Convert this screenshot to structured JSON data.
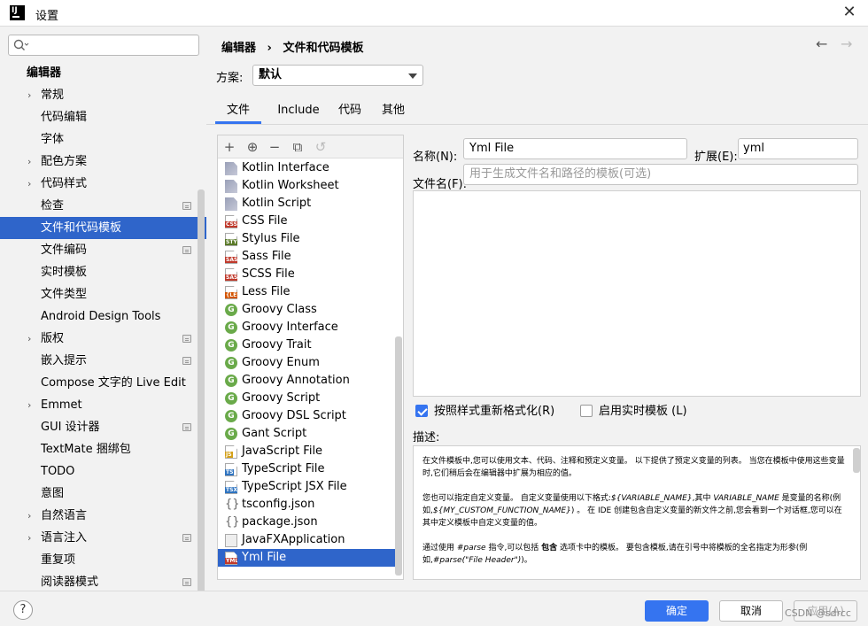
{
  "window": {
    "title": "设置",
    "logo": "IJ"
  },
  "search": {
    "placeholder": ""
  },
  "sidebar": {
    "items": [
      {
        "label": "编辑器"
      },
      {
        "label": "常规"
      },
      {
        "label": "代码编辑"
      },
      {
        "label": "字体"
      },
      {
        "label": "配色方案"
      },
      {
        "label": "代码样式"
      },
      {
        "label": "检查"
      },
      {
        "label": "文件和代码模板"
      },
      {
        "label": "文件编码"
      },
      {
        "label": "实时模板"
      },
      {
        "label": "文件类型"
      },
      {
        "label": "Android Design Tools"
      },
      {
        "label": "版权"
      },
      {
        "label": "嵌入提示"
      },
      {
        "label": "Compose 文字的 Live Edit"
      },
      {
        "label": "Emmet"
      },
      {
        "label": "GUI 设计器"
      },
      {
        "label": "TextMate 捆绑包"
      },
      {
        "label": "TODO"
      },
      {
        "label": "意图"
      },
      {
        "label": "自然语言"
      },
      {
        "label": "语言注入"
      },
      {
        "label": "重复项"
      },
      {
        "label": "阅读器模式"
      }
    ]
  },
  "breadcrumb": {
    "parent": "编辑器",
    "separator": "›",
    "current": "文件和代码模板"
  },
  "scheme": {
    "label": "方案:",
    "value": "默认"
  },
  "tabs": [
    {
      "label": "文件"
    },
    {
      "label": "Include"
    },
    {
      "label": "代码"
    },
    {
      "label": "其他"
    }
  ],
  "toolbar": {
    "add": "+",
    "copy_add": "⊕",
    "remove": "−",
    "copy": "⧉",
    "reset": "↺"
  },
  "templates": [
    {
      "label": "Kotlin Interface",
      "icon": "kotlin"
    },
    {
      "label": "Kotlin Worksheet",
      "icon": "kotlin"
    },
    {
      "label": "Kotlin Script",
      "icon": "kotlin"
    },
    {
      "label": "CSS File",
      "icon": "doc",
      "tag": "CSS",
      "color": "#c0392b"
    },
    {
      "label": "Stylus File",
      "icon": "doc",
      "tag": "STYL",
      "color": "#5a7a28"
    },
    {
      "label": "Sass File",
      "icon": "doc",
      "tag": "SASS",
      "color": "#c0392b"
    },
    {
      "label": "SCSS File",
      "icon": "doc",
      "tag": "SASS",
      "color": "#c0392b"
    },
    {
      "label": "Less File",
      "icon": "doc",
      "tag": "{LES}",
      "color": "#d35400"
    },
    {
      "label": "Groovy Class",
      "icon": "groovy",
      "tag": "G"
    },
    {
      "label": "Groovy Interface",
      "icon": "groovy",
      "tag": "G"
    },
    {
      "label": "Groovy Trait",
      "icon": "groovy",
      "tag": "G"
    },
    {
      "label": "Groovy Enum",
      "icon": "groovy",
      "tag": "G"
    },
    {
      "label": "Groovy Annotation",
      "icon": "groovy",
      "tag": "G"
    },
    {
      "label": "Groovy Script",
      "icon": "groovy",
      "tag": "G"
    },
    {
      "label": "Groovy DSL Script",
      "icon": "groovy",
      "tag": "G"
    },
    {
      "label": "Gant Script",
      "icon": "groovy",
      "tag": "G"
    },
    {
      "label": "JavaScript File",
      "icon": "doc",
      "tag": "JS",
      "color": "#d4a017"
    },
    {
      "label": "TypeScript File",
      "icon": "doc",
      "tag": "TS",
      "color": "#2f74c0"
    },
    {
      "label": "TypeScript JSX File",
      "icon": "doc",
      "tag": "TSX",
      "color": "#2f74c0"
    },
    {
      "label": "tsconfig.json",
      "icon": "json",
      "tag": "{}"
    },
    {
      "label": "package.json",
      "icon": "json",
      "tag": "{}"
    },
    {
      "label": "JavaFXApplication",
      "icon": "java"
    },
    {
      "label": "Yml File",
      "icon": "doc",
      "tag": "YML",
      "color": "#c0392b"
    }
  ],
  "form": {
    "name_label": "名称(N):",
    "name_value": "Yml File",
    "ext_label": "扩展(E):",
    "ext_value": "yml",
    "filename_label": "文件名(F):",
    "filename_placeholder": "用于生成文件名和路径的模板(可选)",
    "reformat_label": "按照样式重新格式化(R)",
    "reformat_checked": true,
    "live_label": "启用实时模板 (L)",
    "live_checked": false,
    "desc_label": "描述:"
  },
  "description": {
    "p1": "在文件模板中,您可以使用文本、代码、注释和预定义变量。 以下提供了预定义变量的列表。 当您在模板中使用这些变量时,它们稍后会在编辑器中扩展为相应的值。",
    "p2_a": "您也可以指定自定义变量。 自定义变量使用以下格式:",
    "p2_var": "${VARIABLE_NAME}",
    "p2_b": ",其中 ",
    "p2_var2": "VARIABLE_NAME",
    "p2_c": " 是变量的名称(例如,",
    "p2_var3": "${MY_CUSTOM_FUNCTION_NAME}",
    "p2_d": ") 。 在 IDE 创建包含自定义变量的新文件之前,您会看到一个对话框,您可以在其中定义模板中自定义变量的值。",
    "p3_a": "通过使用 ",
    "p3_kw": "#parse",
    "p3_b": " 指令,可以包括 ",
    "p3_bold": "包含",
    "p3_c": " 选项卡中的模板。 要包含模板,请在引号中将模板的全名指定为形参(例如,",
    "p3_kw2": "#parse(\"File Header\")",
    "p3_d": ")。"
  },
  "buttons": {
    "ok": "确定",
    "cancel": "取消",
    "apply": "应用(A)",
    "help": "?"
  },
  "watermark": "CSDN @sdrcc",
  "colors": {
    "selection": "#2f65ca",
    "primary": "#3574f0",
    "groovy": "#6aaa4a"
  }
}
